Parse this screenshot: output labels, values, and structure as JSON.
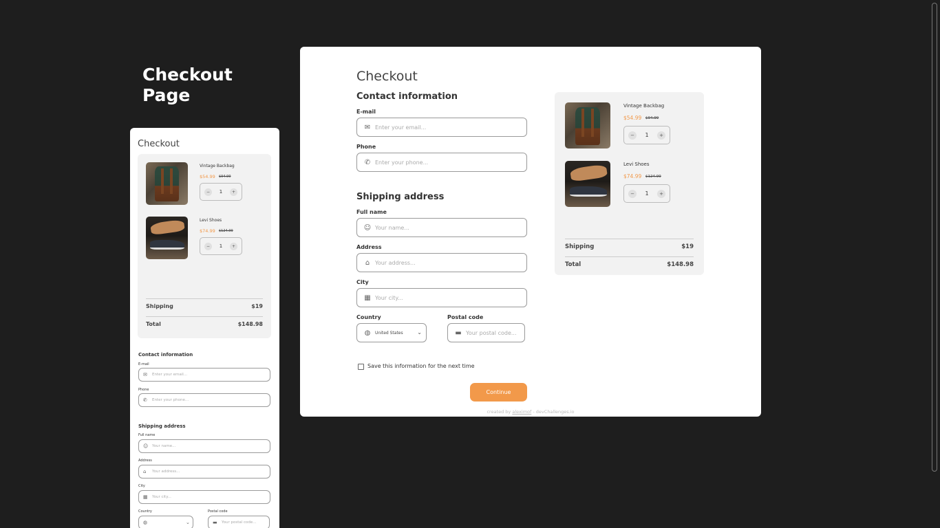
{
  "page_heading": "Checkout Page",
  "colors": {
    "background": "#1e1e1e",
    "accent": "#f2994a",
    "card": "#ffffff",
    "cart_bg": "#f2f2f2"
  },
  "checkout": {
    "title": "Checkout",
    "contact_title": "Contact information",
    "email": {
      "label": "E-mail",
      "placeholder": "Enter your email...",
      "icon": "mail-icon"
    },
    "phone": {
      "label": "Phone",
      "placeholder": "Enter your phone...",
      "icon": "phone-icon"
    },
    "shipping_title": "Shipping address",
    "full_name": {
      "label": "Full name",
      "placeholder": "Your name...",
      "icon": "user-icon"
    },
    "address": {
      "label": "Address",
      "placeholder": "Your address...",
      "icon": "home-icon"
    },
    "city": {
      "label": "City",
      "placeholder": "Your city...",
      "icon": "city-icon"
    },
    "country": {
      "label": "Country",
      "value": "United States",
      "icon": "globe-icon"
    },
    "postal": {
      "label": "Postal code",
      "placeholder": "Your postal code...",
      "icon": "mailbox-icon"
    },
    "save_label": "Save this information for the next time",
    "continue_label": "Continue",
    "credit_prefix": "created by",
    "credit_author": "aleximof",
    "credit_suffix": "- devChallenges.io"
  },
  "cart": {
    "items": [
      {
        "name": "Vintage Backbag",
        "price": "$54.99",
        "old_price": "$94.99",
        "quantity": "1"
      },
      {
        "name": "Levi Shoes",
        "price": "$74.99",
        "old_price": "$124.99",
        "quantity": "1"
      }
    ],
    "shipping_label": "Shipping",
    "shipping_value": "$19",
    "total_label": "Total",
    "total_value": "$148.98"
  }
}
